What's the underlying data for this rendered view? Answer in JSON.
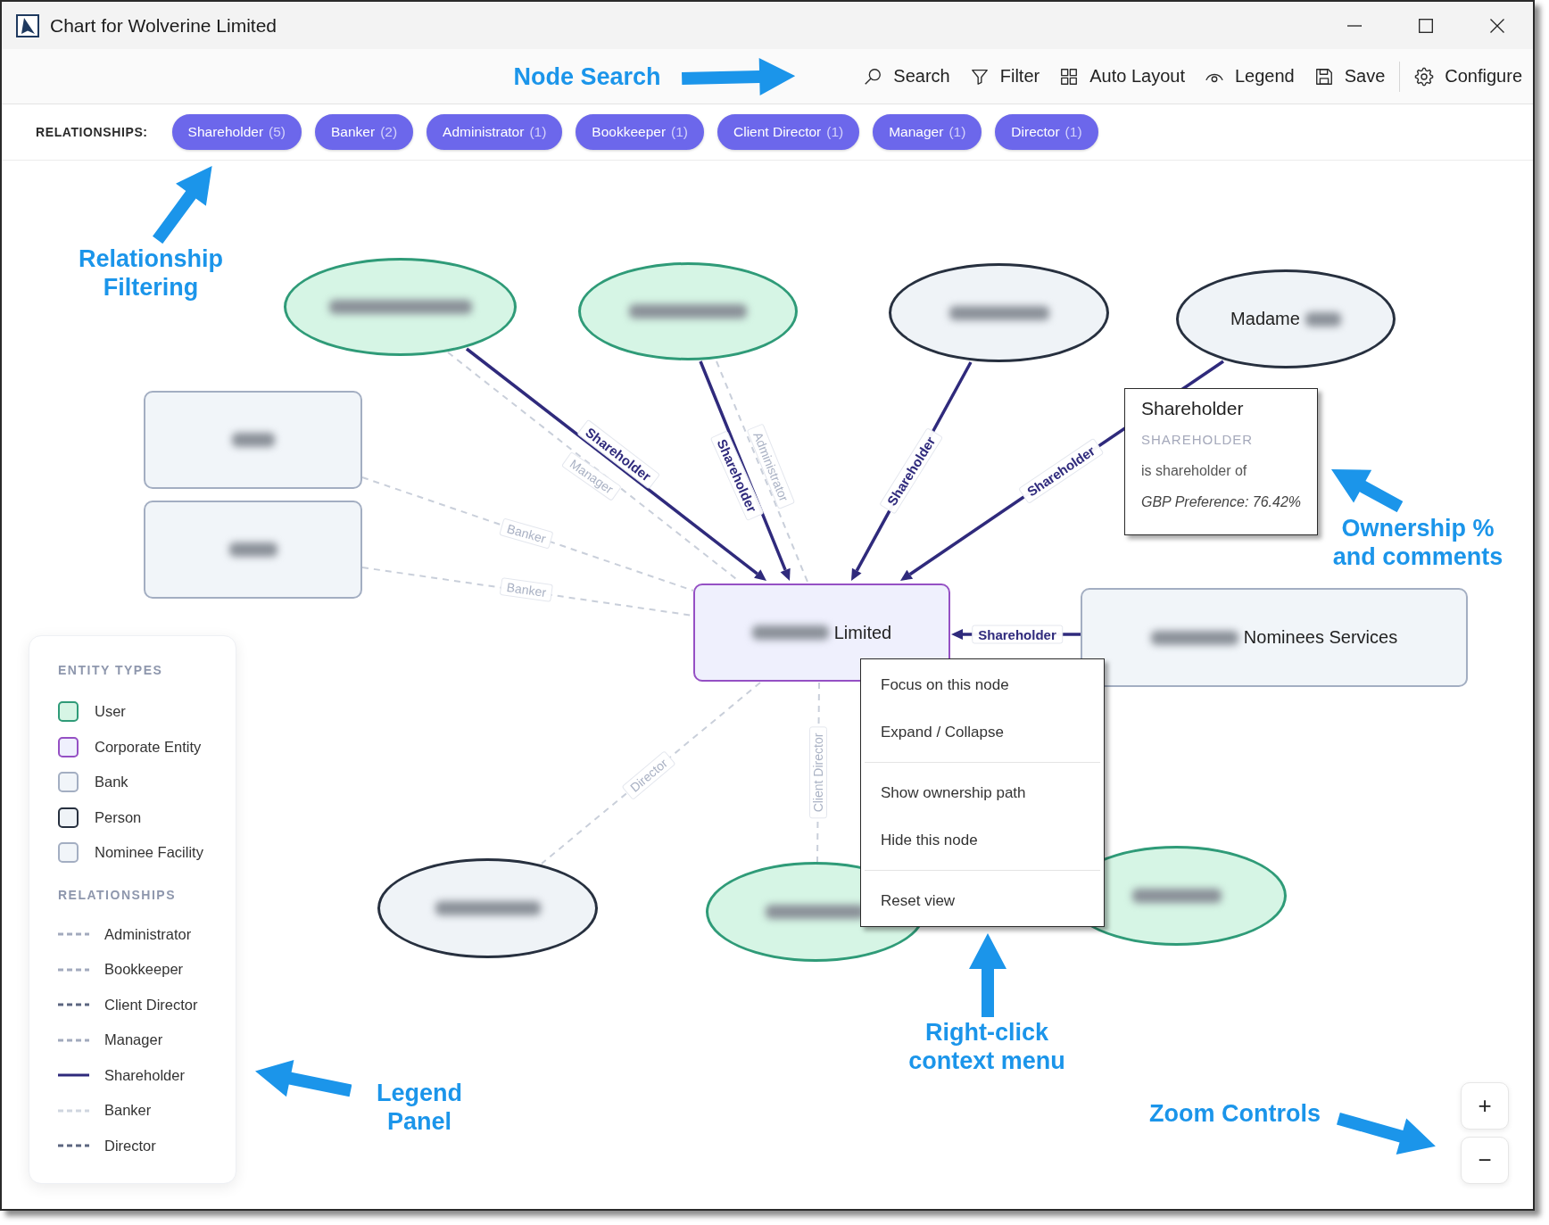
{
  "window": {
    "title": "Chart for Wolverine Limited"
  },
  "toolbar": {
    "groups": [
      [
        {
          "kind": "search",
          "label": "Search"
        },
        {
          "kind": "filter",
          "label": "Filter"
        },
        {
          "kind": "layout",
          "label": "Auto Layout"
        },
        {
          "kind": "legend",
          "label": "Legend"
        },
        {
          "kind": "save",
          "label": "Save"
        }
      ],
      [
        {
          "kind": "configure",
          "label": "Configure"
        }
      ]
    ]
  },
  "relationship_filter": {
    "label": "RELATIONSHIPS:",
    "chips": [
      {
        "label": "Shareholder",
        "count": "(5)",
        "active": true
      },
      {
        "label": "Banker",
        "count": "(2)",
        "active": true
      },
      {
        "label": "Administrator",
        "count": "(1)",
        "active": true
      },
      {
        "label": "Bookkeeper",
        "count": "(1)",
        "active": true
      },
      {
        "label": "Client Director",
        "count": "(1)",
        "active": true
      },
      {
        "label": "Manager",
        "count": "(1)",
        "active": true
      },
      {
        "label": "Director",
        "count": "(1)",
        "active": true
      }
    ]
  },
  "graph": {
    "nodes": [
      {
        "kind": "user",
        "blurred_before": true,
        "blurred_after": false
      },
      {
        "kind": "user",
        "blurred_before": true,
        "blurred_after": false
      },
      {
        "kind": "person",
        "blurred_before": true,
        "blurred_after": false
      },
      {
        "kind": "person",
        "label": "Madame",
        "blurred_before": false,
        "blurred_after": true
      },
      {
        "kind": "bank",
        "blurred_before": true,
        "blurred_after": false
      },
      {
        "kind": "bank",
        "blurred_before": true,
        "blurred_after": false
      },
      {
        "kind": "corporate",
        "label": "Limited",
        "blurred_before": true,
        "blurred_after": false
      },
      {
        "kind": "nominee",
        "label": "Nominees Services",
        "blurred_before": true,
        "blurred_after": false
      },
      {
        "kind": "person",
        "blurred_before": true,
        "blurred_after": false
      },
      {
        "kind": "user",
        "blurred_before": true,
        "blurred_after": false
      },
      {
        "kind": "user",
        "blurred_before": true,
        "blurred_after": false
      }
    ],
    "edges": [
      {
        "kind": "solid",
        "label": "Shareholder"
      },
      {
        "kind": "dashed",
        "label": "Manager"
      },
      {
        "kind": "solid",
        "label": "Shareholder"
      },
      {
        "kind": "dashed",
        "label": "Administrator"
      },
      {
        "kind": "solid",
        "label": "Shareholder"
      },
      {
        "kind": "solid",
        "label": "Shareholder"
      },
      {
        "kind": "dashed",
        "label": "Banker"
      },
      {
        "kind": "dashed",
        "label": "Banker"
      },
      {
        "kind": "solid",
        "label": "Shareholder"
      },
      {
        "kind": "dashed",
        "label": "Director"
      },
      {
        "kind": "dashed",
        "label": "Client Director"
      }
    ]
  },
  "tooltip": {
    "title": "Shareholder",
    "type": "SHAREHOLDER",
    "description": "is shareholder of",
    "note": "GBP Preference: 76.42%"
  },
  "context_menu": {
    "groups": [
      [
        "Focus on this node",
        "Expand / Collapse"
      ],
      [
        "Show ownership path",
        "Hide this node"
      ],
      [
        "Reset view"
      ]
    ]
  },
  "legend": {
    "entity_title": "ENTITY TYPES",
    "entity_types": [
      {
        "kind": "user",
        "label": "User",
        "color": "#2f9b78"
      },
      {
        "kind": "corporate",
        "label": "Corporate Entity",
        "color": "#9550c4"
      },
      {
        "kind": "bank",
        "label": "Bank",
        "color": "#a3aec2"
      },
      {
        "kind": "person",
        "label": "Person",
        "color": "#27303f"
      },
      {
        "kind": "nominee",
        "label": "Nominee Facility",
        "color": "#a3aec2"
      }
    ],
    "relationship_title": "RELATIONSHIPS",
    "relationships": [
      {
        "kind": "dashed",
        "label": "Administrator",
        "color": "#a2aabd"
      },
      {
        "kind": "dashed",
        "label": "Bookkeeper",
        "color": "#a2aabd"
      },
      {
        "kind": "dashed",
        "label": "Client Director",
        "color": "#5c6680"
      },
      {
        "kind": "dashed",
        "label": "Manager",
        "color": "#a2aabd"
      },
      {
        "kind": "solid",
        "label": "Shareholder",
        "color": "#2f2a7c"
      },
      {
        "kind": "dashed",
        "label": "Banker",
        "color": "#cfd5df"
      },
      {
        "kind": "dashed",
        "label": "Director",
        "color": "#5c6680"
      }
    ]
  },
  "zoom_controls": [
    "+",
    "−"
  ],
  "annotations": [
    {
      "text": "Node Search"
    },
    {
      "text": "Relationship\nFiltering"
    },
    {
      "text": "Ownership %\nand comments"
    },
    {
      "text": "Legend\nPanel"
    },
    {
      "text": "Right-click\ncontext menu"
    },
    {
      "text": "Zoom Controls"
    }
  ]
}
